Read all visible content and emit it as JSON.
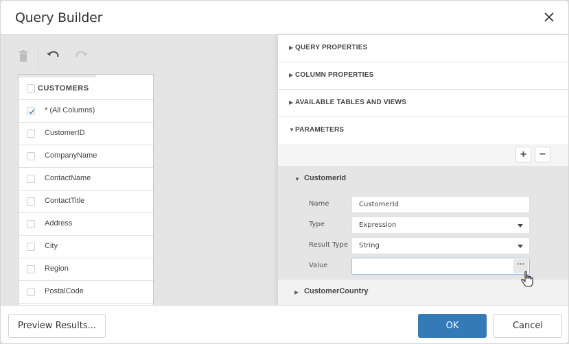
{
  "dialog": {
    "title": "Query Builder",
    "close_icon": "close-icon"
  },
  "toolbar": {
    "delete_icon": "trash-icon",
    "undo_icon": "undo-icon",
    "redo_icon": "redo-icon"
  },
  "table": {
    "name": "CUSTOMERS",
    "header_checked": false,
    "columns": [
      {
        "label": "* (All Columns)",
        "checked": true
      },
      {
        "label": "CustomerID",
        "checked": false
      },
      {
        "label": "CompanyName",
        "checked": false
      },
      {
        "label": "ContactName",
        "checked": false
      },
      {
        "label": "ContactTitle",
        "checked": false
      },
      {
        "label": "Address",
        "checked": false
      },
      {
        "label": "City",
        "checked": false
      },
      {
        "label": "Region",
        "checked": false
      },
      {
        "label": "PostalCode",
        "checked": false
      }
    ]
  },
  "sections": [
    {
      "label": "QUERY PROPERTIES",
      "expanded": false,
      "arrow": "▶"
    },
    {
      "label": "COLUMN PROPERTIES",
      "expanded": false,
      "arrow": "▶"
    },
    {
      "label": "AVAILABLE TABLES AND VIEWS",
      "expanded": false,
      "arrow": "▶"
    },
    {
      "label": "PARAMETERS",
      "expanded": true,
      "arrow": "▼"
    }
  ],
  "parameters": {
    "add_label": "+",
    "remove_label": "−",
    "items": [
      {
        "name": "CustomerId",
        "expanded": true,
        "arrow": "▼",
        "props": {
          "name_label": "Name",
          "name_value": "CustomerId",
          "type_label": "Type",
          "type_value": "Expression",
          "result_type_label": "Result Type",
          "result_type_value": "String",
          "value_label": "Value",
          "value_value": "",
          "ellipsis_label": "···"
        }
      },
      {
        "name": "CustomerCountry",
        "expanded": false,
        "arrow": "▶"
      }
    ]
  },
  "footer": {
    "preview_label": "Preview Results...",
    "ok_label": "OK",
    "cancel_label": "Cancel"
  },
  "colors": {
    "primary": "#337ab7",
    "check": "#337ab7"
  }
}
